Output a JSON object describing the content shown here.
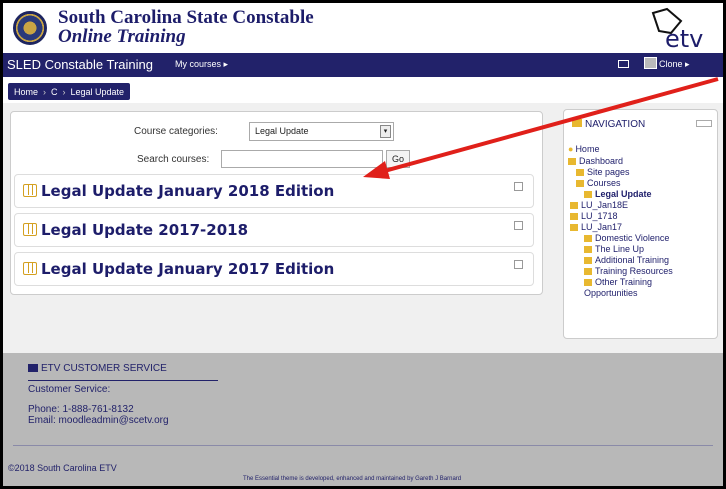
{
  "header": {
    "site_name_line1": "South Carolina State Constable",
    "site_name_line2": "Online Training",
    "logo_text": "etv"
  },
  "navbar": {
    "brand": "SLED Constable Training",
    "my_courses": "My courses ▸",
    "user_menu": "Clone ▸"
  },
  "breadcrumb": {
    "items": [
      "Home",
      "C",
      "Legal Update"
    ]
  },
  "course_search": {
    "categories_label": "Course categories:",
    "categories_selected": "Legal Update",
    "search_label": "Search courses:",
    "search_value": "",
    "go_label": "Go"
  },
  "courses": [
    {
      "title": "Legal Update January 2018 Edition"
    },
    {
      "title": "Legal Update 2017-2018"
    },
    {
      "title": "Legal Update January 2017 Edition"
    }
  ],
  "navigation": {
    "heading": "NAVIGATION",
    "items": [
      "Home",
      "Dashboard",
      "Site pages",
      "Courses",
      "Legal Update",
      "LU_Jan18E",
      "LU_1718",
      "LU_Jan17",
      "Domestic Violence",
      "The Line Up",
      "Additional Training",
      "Training Resources",
      "Other Training",
      "Opportunities"
    ]
  },
  "footer": {
    "cs_title": "ETV CUSTOMER SERVICE",
    "cs_label": "Customer Service:",
    "phone": "Phone: 1-888-761-8132",
    "email": "Email: moodleadmin@scetv.org",
    "copyright": "©2018 South Carolina ETV",
    "theme_credit": "The Essential theme is developed, enhanced and maintained by Gareth J Barnard"
  },
  "colors": {
    "brand_navy": "#22226a",
    "accent_gold": "#e8b830",
    "annotation_arrow": "#e0201a"
  }
}
